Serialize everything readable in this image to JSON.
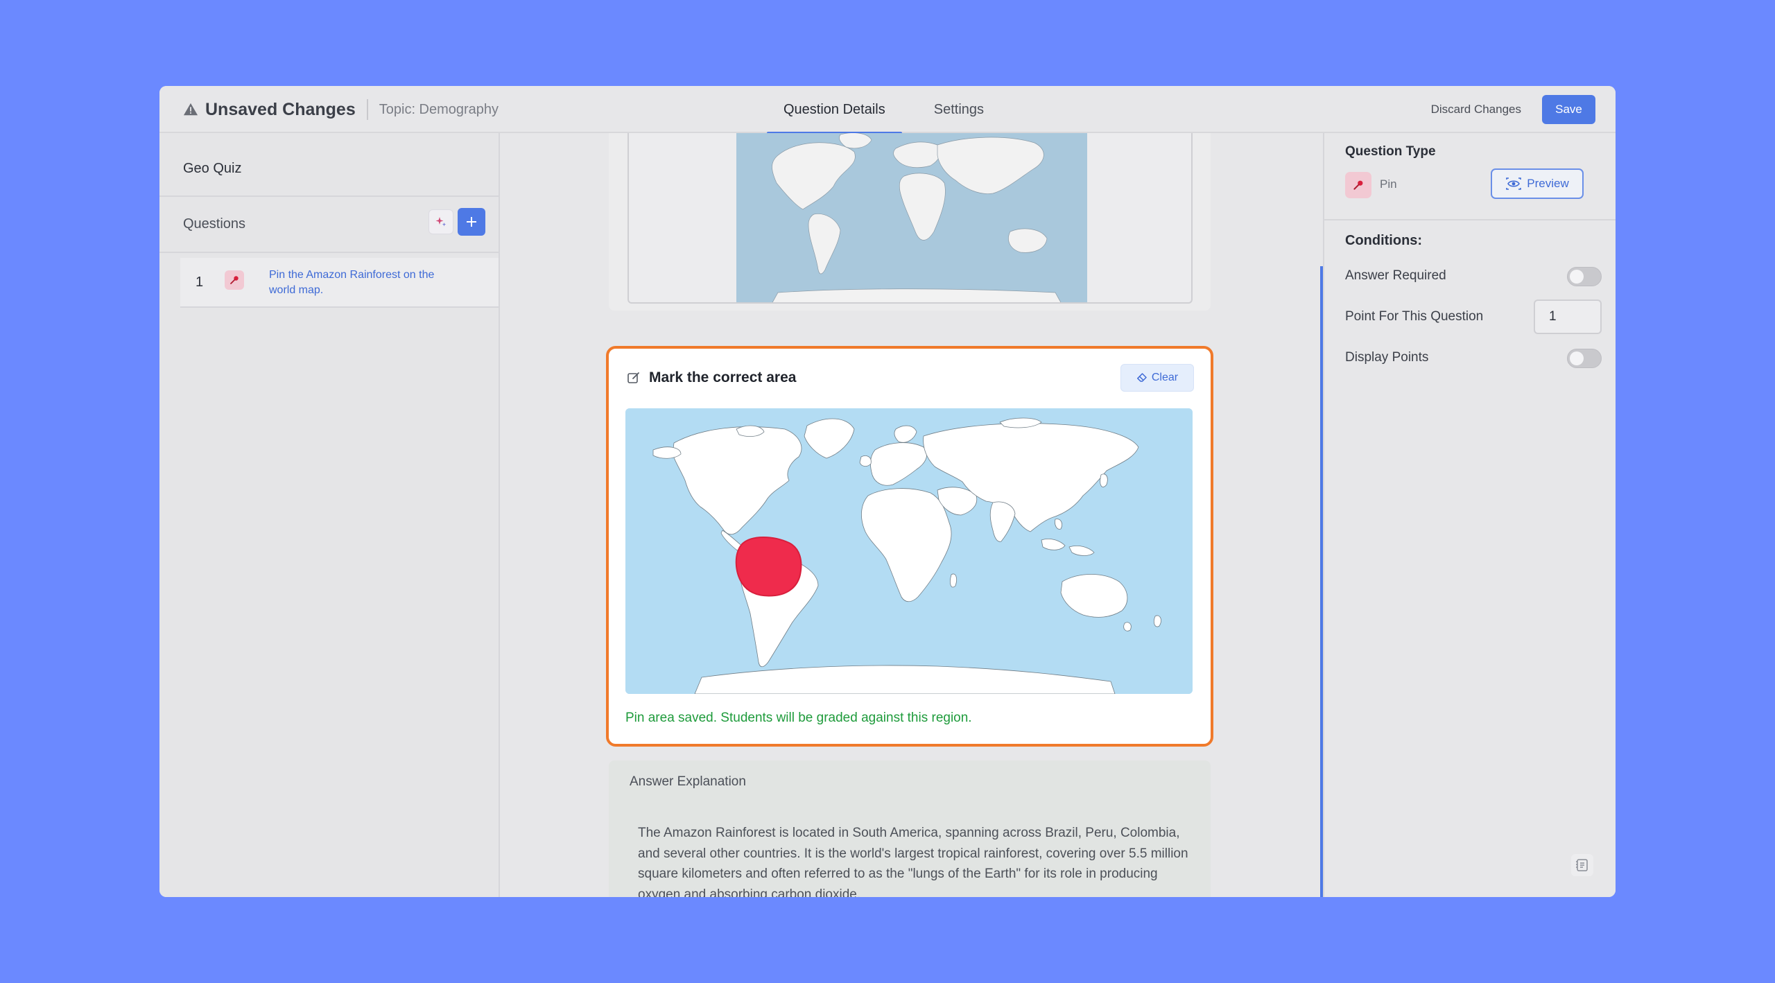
{
  "header": {
    "warning_icon": "warning-triangle-icon",
    "title": "Unsaved Changes",
    "topic": "Topic: Demography",
    "tabs": [
      {
        "label": "Question Details",
        "active": true
      },
      {
        "label": "Settings",
        "active": false
      }
    ],
    "discard_label": "Discard Changes",
    "save_label": "Save"
  },
  "sidebar": {
    "quiz_name": "Geo Quiz",
    "questions_header": "Questions",
    "ai_icon": "sparkle-icon",
    "add_icon": "plus-icon",
    "questions": [
      {
        "number": "1",
        "icon": "pin-icon",
        "text": "Pin the Amazon Rainforest on the world map."
      }
    ]
  },
  "editor": {
    "card_title": "Mark the correct area",
    "edit_icon": "edit-icon",
    "clear_label": "Clear",
    "clear_icon": "eraser-icon",
    "saved_message": "Pin area saved. Students will be graded against this region.",
    "explanation_label": "Answer Explanation",
    "explanation_text": "The Amazon Rainforest is located in South America, spanning across Brazil, Peru, Colombia, and several other countries. It is the world's largest tropical rainforest, covering over 5.5 million square kilometers and often referred to as the \"lungs of the Earth\" for its role in producing oxygen and absorbing carbon dioxide."
  },
  "right_panel": {
    "question_type_label": "Question Type",
    "question_type": "Pin",
    "question_type_icon": "pin-icon",
    "preview_label": "Preview",
    "preview_icon": "eye-icon",
    "conditions_title": "Conditions:",
    "answer_required_label": "Answer Required",
    "answer_required": false,
    "points_label": "Point For This Question",
    "points_value": "1",
    "display_points_label": "Display Points",
    "display_points": false,
    "notes_icon": "notes-icon"
  },
  "colors": {
    "background": "#6b89ff",
    "accent": "#4e79e5",
    "highlight_border": "#f07a2b",
    "pin_area": "#ef2b4c",
    "success_text": "#1e9b3b",
    "ocean": "#b3dcf3"
  }
}
